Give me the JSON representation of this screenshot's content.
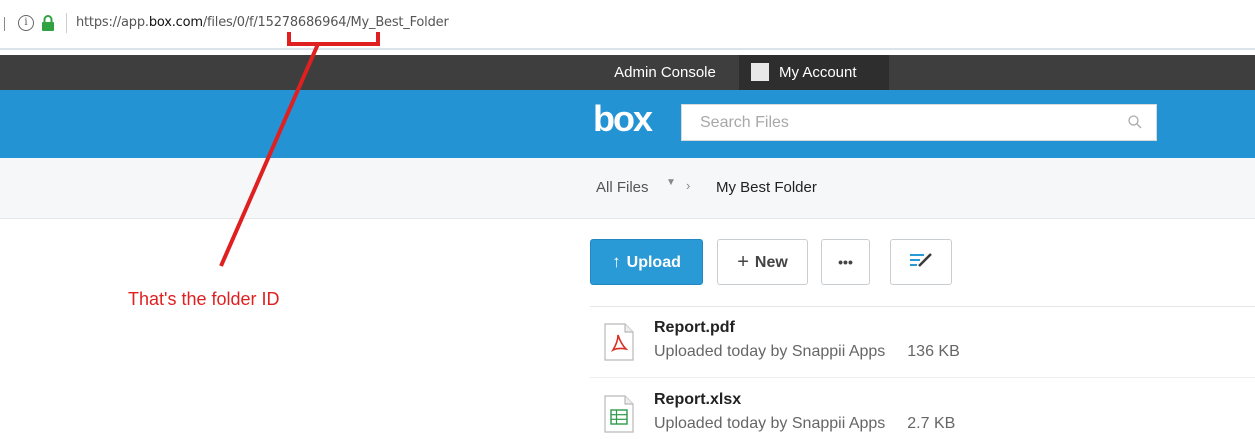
{
  "browser": {
    "url_prefix": "https://app.",
    "url_domain": "box.com",
    "url_path": "/files/0/f/15278686964/My_Best_Folder"
  },
  "topbar": {
    "admin_console": "Admin Console",
    "my_account": "My Account"
  },
  "header": {
    "logo": "box",
    "search_placeholder": "Search Files"
  },
  "breadcrumb": {
    "all_files": "All Files",
    "current": "My Best Folder"
  },
  "toolbar": {
    "upload_label": "Upload",
    "new_label": "New",
    "more_label": "•••"
  },
  "files": [
    {
      "name": "Report.pdf",
      "meta": "Uploaded today by Snappii Apps",
      "size": "136 KB",
      "type": "pdf-icon"
    },
    {
      "name": "Report.xlsx",
      "meta": "Uploaded today by Snappii Apps",
      "size": "2.7 KB",
      "type": "spreadsheet-icon"
    }
  ],
  "annotation": {
    "text": "That's the folder ID",
    "color": "#e02020"
  },
  "colors": {
    "brand_blue": "#2393d4",
    "upload_blue": "#2a9ad6",
    "topbar": "#3e3e3e"
  }
}
